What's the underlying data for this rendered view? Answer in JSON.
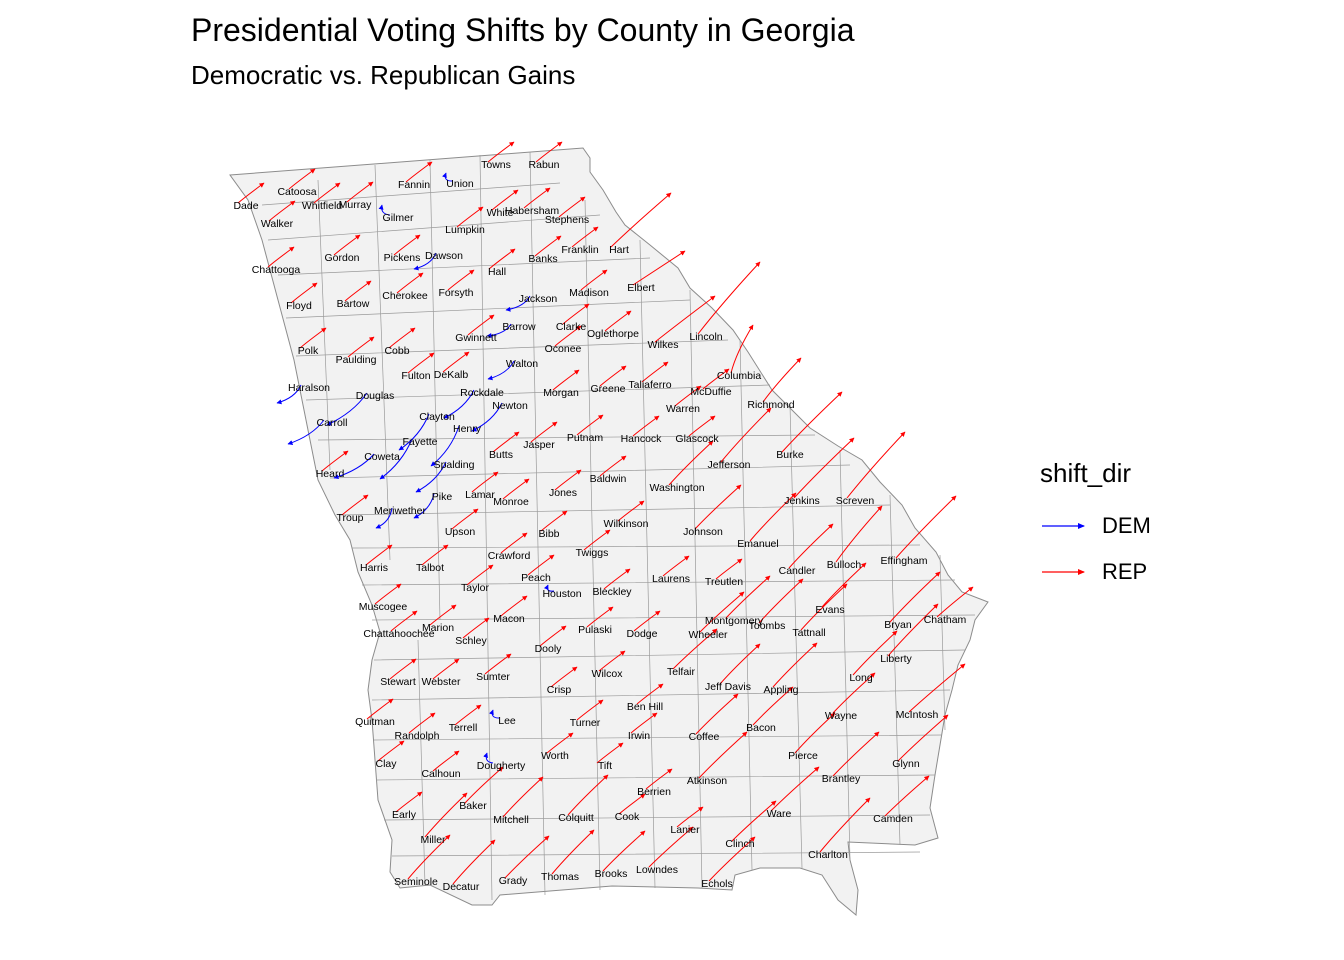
{
  "title": "Presidential Voting Shifts by County in Georgia",
  "subtitle": "Democratic vs. Republican Gains",
  "legend": {
    "title": "shift_dir",
    "items": [
      {
        "label": "DEM",
        "color": "#0000ff"
      },
      {
        "label": "REP",
        "color": "#ff0000"
      }
    ]
  },
  "map_style": {
    "fill": "#f2f2f2",
    "border": "#8c8c8c"
  },
  "counties": [
    {
      "name": "Dade",
      "dir": "REP"
    },
    {
      "name": "Catoosa",
      "dir": "REP"
    },
    {
      "name": "Whitfield",
      "dir": "REP"
    },
    {
      "name": "Murray",
      "dir": "REP"
    },
    {
      "name": "Fannin",
      "dir": "REP"
    },
    {
      "name": "Union",
      "dir": "DEM"
    },
    {
      "name": "Towns",
      "dir": "REP"
    },
    {
      "name": "Rabun",
      "dir": "REP"
    },
    {
      "name": "Walker",
      "dir": "REP"
    },
    {
      "name": "Gilmer",
      "dir": "DEM"
    },
    {
      "name": "White",
      "dir": "REP"
    },
    {
      "name": "Habersham",
      "dir": "REP"
    },
    {
      "name": "Stephens",
      "dir": "REP"
    },
    {
      "name": "Lumpkin",
      "dir": "REP"
    },
    {
      "name": "Chattooga",
      "dir": "REP"
    },
    {
      "name": "Gordon",
      "dir": "REP"
    },
    {
      "name": "Pickens",
      "dir": "REP"
    },
    {
      "name": "Dawson",
      "dir": "DEM"
    },
    {
      "name": "Franklin",
      "dir": "REP"
    },
    {
      "name": "Hart",
      "dir": "REP"
    },
    {
      "name": "Banks",
      "dir": "REP"
    },
    {
      "name": "Hall",
      "dir": "REP"
    },
    {
      "name": "Elbert",
      "dir": "REP"
    },
    {
      "name": "Floyd",
      "dir": "REP"
    },
    {
      "name": "Bartow",
      "dir": "REP"
    },
    {
      "name": "Cherokee",
      "dir": "REP"
    },
    {
      "name": "Forsyth",
      "dir": "REP"
    },
    {
      "name": "Jackson",
      "dir": "DEM"
    },
    {
      "name": "Madison",
      "dir": "REP"
    },
    {
      "name": "Barrow",
      "dir": "DEM"
    },
    {
      "name": "Clarke",
      "dir": "REP"
    },
    {
      "name": "Oglethorpe",
      "dir": "REP"
    },
    {
      "name": "Lincoln",
      "dir": "REP"
    },
    {
      "name": "Gwinnett",
      "dir": "REP"
    },
    {
      "name": "Wilkes",
      "dir": "REP"
    },
    {
      "name": "Polk",
      "dir": "REP"
    },
    {
      "name": "Cobb",
      "dir": "REP"
    },
    {
      "name": "Paulding",
      "dir": "REP"
    },
    {
      "name": "Oconee",
      "dir": "REP"
    },
    {
      "name": "Walton",
      "dir": "DEM"
    },
    {
      "name": "Fulton",
      "dir": "REP"
    },
    {
      "name": "DeKalb",
      "dir": "REP"
    },
    {
      "name": "Columbia",
      "dir": "REP"
    },
    {
      "name": "Haralson",
      "dir": "DEM"
    },
    {
      "name": "Rockdale",
      "dir": "DEM"
    },
    {
      "name": "Greene",
      "dir": "REP"
    },
    {
      "name": "Taliaferro",
      "dir": "REP"
    },
    {
      "name": "McDuffie",
      "dir": "REP"
    },
    {
      "name": "Douglas",
      "dir": "DEM"
    },
    {
      "name": "Morgan",
      "dir": "REP"
    },
    {
      "name": "Newton",
      "dir": "DEM"
    },
    {
      "name": "Warren",
      "dir": "REP"
    },
    {
      "name": "Richmond",
      "dir": "REP"
    },
    {
      "name": "Clayton",
      "dir": "DEM"
    },
    {
      "name": "Carroll",
      "dir": "DEM"
    },
    {
      "name": "Henry",
      "dir": "DEM"
    },
    {
      "name": "Fayette",
      "dir": "DEM"
    },
    {
      "name": "Jasper",
      "dir": "REP"
    },
    {
      "name": "Putnam",
      "dir": "REP"
    },
    {
      "name": "Hancock",
      "dir": "REP"
    },
    {
      "name": "Glascock",
      "dir": "REP"
    },
    {
      "name": "Coweta",
      "dir": "DEM"
    },
    {
      "name": "Butts",
      "dir": "REP"
    },
    {
      "name": "Burke",
      "dir": "REP"
    },
    {
      "name": "Jefferson",
      "dir": "REP"
    },
    {
      "name": "Spalding",
      "dir": "DEM"
    },
    {
      "name": "Heard",
      "dir": "REP"
    },
    {
      "name": "Baldwin",
      "dir": "REP"
    },
    {
      "name": "Pike",
      "dir": "DEM"
    },
    {
      "name": "Lamar",
      "dir": "REP"
    },
    {
      "name": "Washington",
      "dir": "REP"
    },
    {
      "name": "Jones",
      "dir": "REP"
    },
    {
      "name": "Monroe",
      "dir": "REP"
    },
    {
      "name": "Jenkins",
      "dir": "REP"
    },
    {
      "name": "Screven",
      "dir": "REP"
    },
    {
      "name": "Troup",
      "dir": "REP"
    },
    {
      "name": "Meriwether",
      "dir": "DEM"
    },
    {
      "name": "Upson",
      "dir": "REP"
    },
    {
      "name": "Wilkinson",
      "dir": "REP"
    },
    {
      "name": "Johnson",
      "dir": "REP"
    },
    {
      "name": "Bibb",
      "dir": "REP"
    },
    {
      "name": "Emanuel",
      "dir": "REP"
    },
    {
      "name": "Twiggs",
      "dir": "REP"
    },
    {
      "name": "Crawford",
      "dir": "REP"
    },
    {
      "name": "Harris",
      "dir": "REP"
    },
    {
      "name": "Talbot",
      "dir": "REP"
    },
    {
      "name": "Effingham",
      "dir": "REP"
    },
    {
      "name": "Bulloch",
      "dir": "REP"
    },
    {
      "name": "Candler",
      "dir": "REP"
    },
    {
      "name": "Peach",
      "dir": "REP"
    },
    {
      "name": "Laurens",
      "dir": "REP"
    },
    {
      "name": "Treutlen",
      "dir": "REP"
    },
    {
      "name": "Taylor",
      "dir": "REP"
    },
    {
      "name": "Houston",
      "dir": "DEM"
    },
    {
      "name": "Bleckley",
      "dir": "REP"
    },
    {
      "name": "Muscogee",
      "dir": "REP"
    },
    {
      "name": "Evans",
      "dir": "REP"
    },
    {
      "name": "Chatham",
      "dir": "REP"
    },
    {
      "name": "Macon",
      "dir": "REP"
    },
    {
      "name": "Montgomery",
      "dir": "REP"
    },
    {
      "name": "Toombs",
      "dir": "REP"
    },
    {
      "name": "Bryan",
      "dir": "REP"
    },
    {
      "name": "Marion",
      "dir": "REP"
    },
    {
      "name": "Pulaski",
      "dir": "REP"
    },
    {
      "name": "Chattahoochee",
      "dir": "REP"
    },
    {
      "name": "Dodge",
      "dir": "REP"
    },
    {
      "name": "Wheeler",
      "dir": "REP"
    },
    {
      "name": "Tattnall",
      "dir": "REP"
    },
    {
      "name": "Schley",
      "dir": "REP"
    },
    {
      "name": "Dooly",
      "dir": "REP"
    },
    {
      "name": "Liberty",
      "dir": "REP"
    },
    {
      "name": "Telfair",
      "dir": "REP"
    },
    {
      "name": "Sumter",
      "dir": "REP"
    },
    {
      "name": "Wilcox",
      "dir": "REP"
    },
    {
      "name": "Long",
      "dir": "REP"
    },
    {
      "name": "Stewart",
      "dir": "REP"
    },
    {
      "name": "Webster",
      "dir": "REP"
    },
    {
      "name": "Crisp",
      "dir": "REP"
    },
    {
      "name": "Jeff Davis",
      "dir": "REP"
    },
    {
      "name": "Appling",
      "dir": "REP"
    },
    {
      "name": "Ben Hill",
      "dir": "REP"
    },
    {
      "name": "Wayne",
      "dir": "REP"
    },
    {
      "name": "McIntosh",
      "dir": "REP"
    },
    {
      "name": "Quitman",
      "dir": "REP"
    },
    {
      "name": "Lee",
      "dir": "DEM"
    },
    {
      "name": "Turner",
      "dir": "REP"
    },
    {
      "name": "Terrell",
      "dir": "REP"
    },
    {
      "name": "Bacon",
      "dir": "REP"
    },
    {
      "name": "Randolph",
      "dir": "REP"
    },
    {
      "name": "Irwin",
      "dir": "REP"
    },
    {
      "name": "Coffee",
      "dir": "REP"
    },
    {
      "name": "Pierce",
      "dir": "REP"
    },
    {
      "name": "Clay",
      "dir": "REP"
    },
    {
      "name": "Worth",
      "dir": "REP"
    },
    {
      "name": "Dougherty",
      "dir": "DEM"
    },
    {
      "name": "Glynn",
      "dir": "REP"
    },
    {
      "name": "Tift",
      "dir": "REP"
    },
    {
      "name": "Calhoun",
      "dir": "REP"
    },
    {
      "name": "Atkinson",
      "dir": "REP"
    },
    {
      "name": "Brantley",
      "dir": "REP"
    },
    {
      "name": "Berrien",
      "dir": "REP"
    },
    {
      "name": "Baker",
      "dir": "REP"
    },
    {
      "name": "Early",
      "dir": "REP"
    },
    {
      "name": "Ware",
      "dir": "REP"
    },
    {
      "name": "Camden",
      "dir": "REP"
    },
    {
      "name": "Mitchell",
      "dir": "REP"
    },
    {
      "name": "Colquitt",
      "dir": "REP"
    },
    {
      "name": "Cook",
      "dir": "REP"
    },
    {
      "name": "Lanier",
      "dir": "REP"
    },
    {
      "name": "Miller",
      "dir": "REP"
    },
    {
      "name": "Clinch",
      "dir": "REP"
    },
    {
      "name": "Charlton",
      "dir": "REP"
    },
    {
      "name": "Thomas",
      "dir": "REP"
    },
    {
      "name": "Grady",
      "dir": "REP"
    },
    {
      "name": "Brooks",
      "dir": "REP"
    },
    {
      "name": "Lowndes",
      "dir": "REP"
    },
    {
      "name": "Seminole",
      "dir": "REP"
    },
    {
      "name": "Decatur",
      "dir": "REP"
    },
    {
      "name": "Echols",
      "dir": "REP"
    }
  ]
}
